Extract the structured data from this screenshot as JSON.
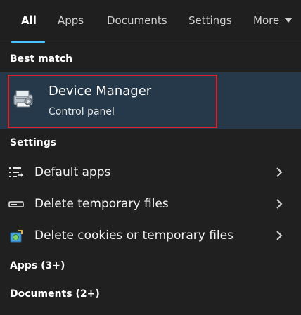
{
  "tabs": [
    {
      "label": "All",
      "active": true
    },
    {
      "label": "Apps",
      "active": false
    },
    {
      "label": "Documents",
      "active": false
    },
    {
      "label": "Settings",
      "active": false
    },
    {
      "label": "More",
      "active": false
    }
  ],
  "best_match": {
    "header": "Best match",
    "title": "Device Manager",
    "subtitle": "Control panel",
    "icon": "device-manager-icon",
    "highlight_color": "#d8232f"
  },
  "settings": {
    "header": "Settings",
    "items": [
      {
        "label": "Default apps",
        "icon": "default-apps-icon"
      },
      {
        "label": "Delete temporary files",
        "icon": "storage-icon"
      },
      {
        "label": "Delete cookies or temporary files",
        "icon": "internet-options-icon"
      }
    ]
  },
  "apps_section": {
    "header": "Apps (3+)"
  },
  "documents_section": {
    "header": "Documents (2+)"
  },
  "colors": {
    "background": "#202020",
    "accent": "#4cc2ff",
    "selected_row": "#25394a"
  }
}
